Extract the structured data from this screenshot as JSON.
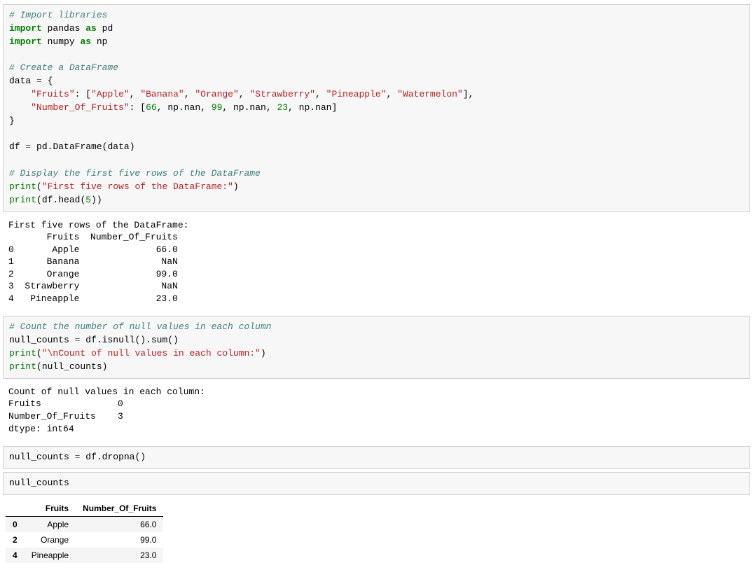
{
  "cell1": {
    "comment_import": "# Import libraries",
    "import1_kw": "import",
    "import1_mod": "pandas",
    "import1_as": "as",
    "import1_alias": "pd",
    "import2_kw": "import",
    "import2_mod": "numpy",
    "import2_as": "as",
    "import2_alias": "np",
    "comment_create": "# Create a DataFrame",
    "data_var": "data",
    "eq": "=",
    "brace_open": "{",
    "key_fruits": "\"Fruits\"",
    "colon": ":",
    "brk_open": "[",
    "f_apple": "\"Apple\"",
    "comma": ",",
    "f_banana": "\"Banana\"",
    "f_orange": "\"Orange\"",
    "f_strawberry": "\"Strawberry\"",
    "f_pineapple": "\"Pineapple\"",
    "f_watermelon": "\"Watermelon\"",
    "brk_close": "]",
    "key_num": "\"Number_Of_Fruits\"",
    "n66": "66",
    "npnan": "np.nan",
    "n99": "99",
    "n23": "23",
    "brace_close": "}",
    "df_var": "df",
    "pd_dataframe": "pd.DataFrame",
    "lp": "(",
    "rp": ")",
    "data_ref": "data",
    "comment_display": "# Display the first five rows of the DataFrame",
    "print_kw": "print",
    "str_first5": "\"First five rows of the DataFrame:\"",
    "head_call": "df.head",
    "five": "5"
  },
  "out1": {
    "line1": "First five rows of the DataFrame:",
    "line2": "       Fruits  Number_Of_Fruits",
    "line3": "0       Apple              66.0",
    "line4": "1      Banana               NaN",
    "line5": "2      Orange              99.0",
    "line6": "3  Strawberry               NaN",
    "line7": "4   Pineapple              23.0"
  },
  "cell2": {
    "comment_count": "# Count the number of null values in each column",
    "nc_var": "null_counts",
    "eq": "=",
    "expr": "df.isnull().sum()",
    "print_kw": "print",
    "str_count": "\"\\nCount of null values in each column:\"",
    "nc_ref": "null_counts"
  },
  "out2": {
    "line1": "Count of null values in each column:",
    "line2": "Fruits              0",
    "line3": "Number_Of_Fruits    3",
    "line4": "dtype: int64"
  },
  "cell3": {
    "nc_var": "null_counts",
    "eq": "=",
    "expr": "df.dropna()"
  },
  "cell4": {
    "nc_var": "null_counts"
  },
  "table": {
    "col1": "Fruits",
    "col2": "Number_Of_Fruits",
    "rows": [
      {
        "idx": "0",
        "fruit": "Apple",
        "num": "66.0"
      },
      {
        "idx": "2",
        "fruit": "Orange",
        "num": "99.0"
      },
      {
        "idx": "4",
        "fruit": "Pineapple",
        "num": "23.0"
      }
    ]
  }
}
